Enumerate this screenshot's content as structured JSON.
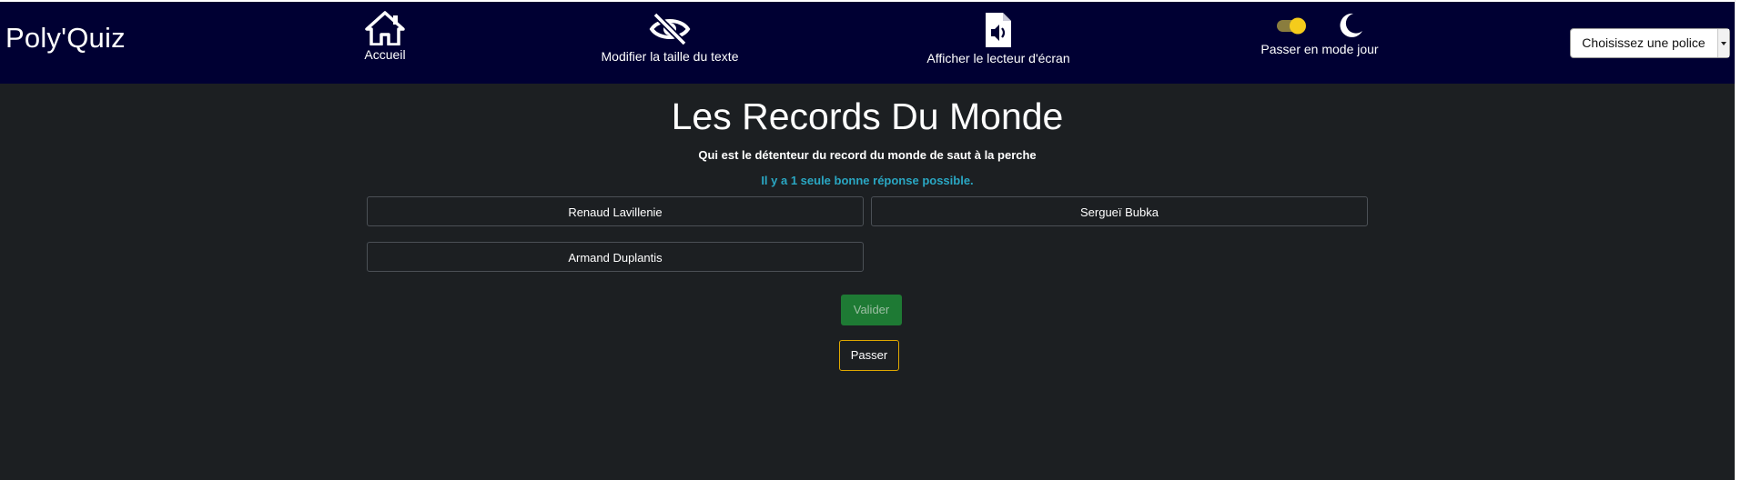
{
  "navbar": {
    "brand": "Poly'Quiz",
    "home_label": "Accueil",
    "text_size_label": "Modifier la taille du texte",
    "screen_reader_label": "Afficher le lecteur d'écran",
    "mode_label": "Passer en mode jour",
    "font_select": {
      "selected": "Choisissez une police"
    }
  },
  "quiz": {
    "title": "Les Records Du Monde",
    "question": "Qui est le détenteur du record du monde de saut à la perche",
    "hint": "Il y a 1 seule bonne réponse possible.",
    "answers": [
      "Renaud Lavillenie",
      "Sergueï Bubka",
      "Armand Duplantis"
    ],
    "validate_label": "Valider",
    "skip_label": "Passer"
  },
  "colors": {
    "navbar_bg": "#000033",
    "page_bg": "#1c1f22",
    "hint": "#2aa7c3",
    "validate_bg": "#1e7a34",
    "skip_border": "#e0a800"
  },
  "icons": {
    "home": "home-icon",
    "text_size": "eye-slash-icon",
    "screen_reader": "audio-file-icon",
    "mode_toggle": "toggle-icon",
    "moon": "moon-icon"
  }
}
